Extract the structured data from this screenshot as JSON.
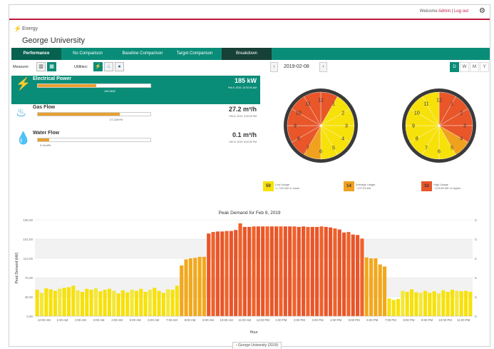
{
  "header": {
    "welcome_text": "Welcome",
    "user": "Admin",
    "separator": "|",
    "logout": "Log out",
    "gear_icon": "gear-icon"
  },
  "app": {
    "name": "Energy",
    "site": "George University",
    "icon": "lightning-icon"
  },
  "tabs": [
    {
      "label": "Performance",
      "active": true
    },
    {
      "label": "No Comparison"
    },
    {
      "label": "Baseline Comparison"
    },
    {
      "label": "Target Comparison"
    },
    {
      "label": "Breakdown"
    }
  ],
  "toolbar": {
    "measure_label": "Measure:",
    "utilities_label": "Utilities:",
    "date": "2019-02-08",
    "prev": "‹",
    "next": "›",
    "periods": [
      "D",
      "W",
      "M",
      "Y"
    ],
    "active_period": "D"
  },
  "utilities": [
    {
      "name": "Electrical Power",
      "value": "185 kW",
      "sub": "184.0kW",
      "time": "Feb 8, 2019, 10:00:00 AM",
      "fill": 0.52,
      "icon": "lightning-icon",
      "selected": true
    },
    {
      "name": "Gas Flow",
      "value": "27.2 m³/h",
      "sub": "27.22m³/h",
      "time": "Feb 8, 2019, 2:00:00 PM",
      "fill": 0.73,
      "icon": "flame-icon"
    },
    {
      "name": "Water Flow",
      "value": "0.1 m³/h",
      "sub": "0.11m³/h",
      "time": "Feb 8, 2019, 8:00:00 PM",
      "fill": 0.1,
      "icon": "water-drop-icon"
    }
  ],
  "clock_numbers": [
    "12",
    "1",
    "2",
    "3",
    "4",
    "5",
    "6",
    "7",
    "8",
    "9",
    "10",
    "11"
  ],
  "usage_legend": [
    {
      "count": "50",
      "title": "Low Usage",
      "desc": "<= 110 kW or lower",
      "color": "#f7e10b"
    },
    {
      "count": "14",
      "title": "Average Usage",
      "desc": "~137.53 kW",
      "color": "#f0a21e"
    },
    {
      "count": "32",
      "title": "High Usage",
      "desc": "~123.65 kW or higher",
      "color": "#e8562a"
    }
  ],
  "colors": {
    "accent": "#0a8d78",
    "low": "#f7e10b",
    "mid": "#f0a21e",
    "high": "#e8562a",
    "brand_line": "#c0163d"
  },
  "chart_data": {
    "type": "bar",
    "title": "Peak Demand for Feb 8, 2019",
    "xlabel": "Hour",
    "ylabel": "Peak Demand (kW)",
    "ylim": [
      0,
      190
    ],
    "yticks": [
      "0.00",
      "38.00",
      "76.00",
      "114.00",
      "152.00",
      "190.00"
    ],
    "xticks": [
      "12:00 AM",
      "1:00 AM",
      "2:00 AM",
      "3:00 AM",
      "4:00 AM",
      "5:00 AM",
      "6:00 AM",
      "7:00 AM",
      "8:00 AM",
      "9:00 AM",
      "10:00 AM",
      "11:00 AM",
      "12:00 PM",
      "1:00 PM",
      "2:00 PM",
      "3:00 PM",
      "4:00 PM",
      "5:00 PM",
      "6:00 PM",
      "7:00 PM",
      "8:00 PM",
      "9:00 PM",
      "10:00 PM",
      "11:00 PM"
    ],
    "series": [
      {
        "name": "George University (2019)",
        "values": [
          52,
          46,
          55,
          53,
          50,
          54,
          56,
          57,
          60,
          51,
          48,
          54,
          52,
          55,
          49,
          52,
          54,
          50,
          45,
          51,
          47,
          52,
          50,
          54,
          48,
          52,
          56,
          50,
          46,
          53,
          52,
          60,
          100,
          112,
          114,
          115,
          117,
          117,
          163,
          166,
          167,
          167,
          168,
          168,
          170,
          183,
          176,
          176,
          177,
          177,
          177,
          177,
          177,
          177,
          177,
          177,
          177,
          177,
          176,
          177,
          176,
          176,
          176,
          177,
          176,
          175,
          173,
          171,
          165,
          166,
          161,
          160,
          153,
          116,
          114,
          114,
          102,
          98,
          35,
          32,
          34,
          50,
          48,
          53,
          47,
          46,
          50,
          46,
          49,
          45,
          51,
          48,
          52,
          50,
          49,
          50,
          48
        ]
      }
    ]
  }
}
